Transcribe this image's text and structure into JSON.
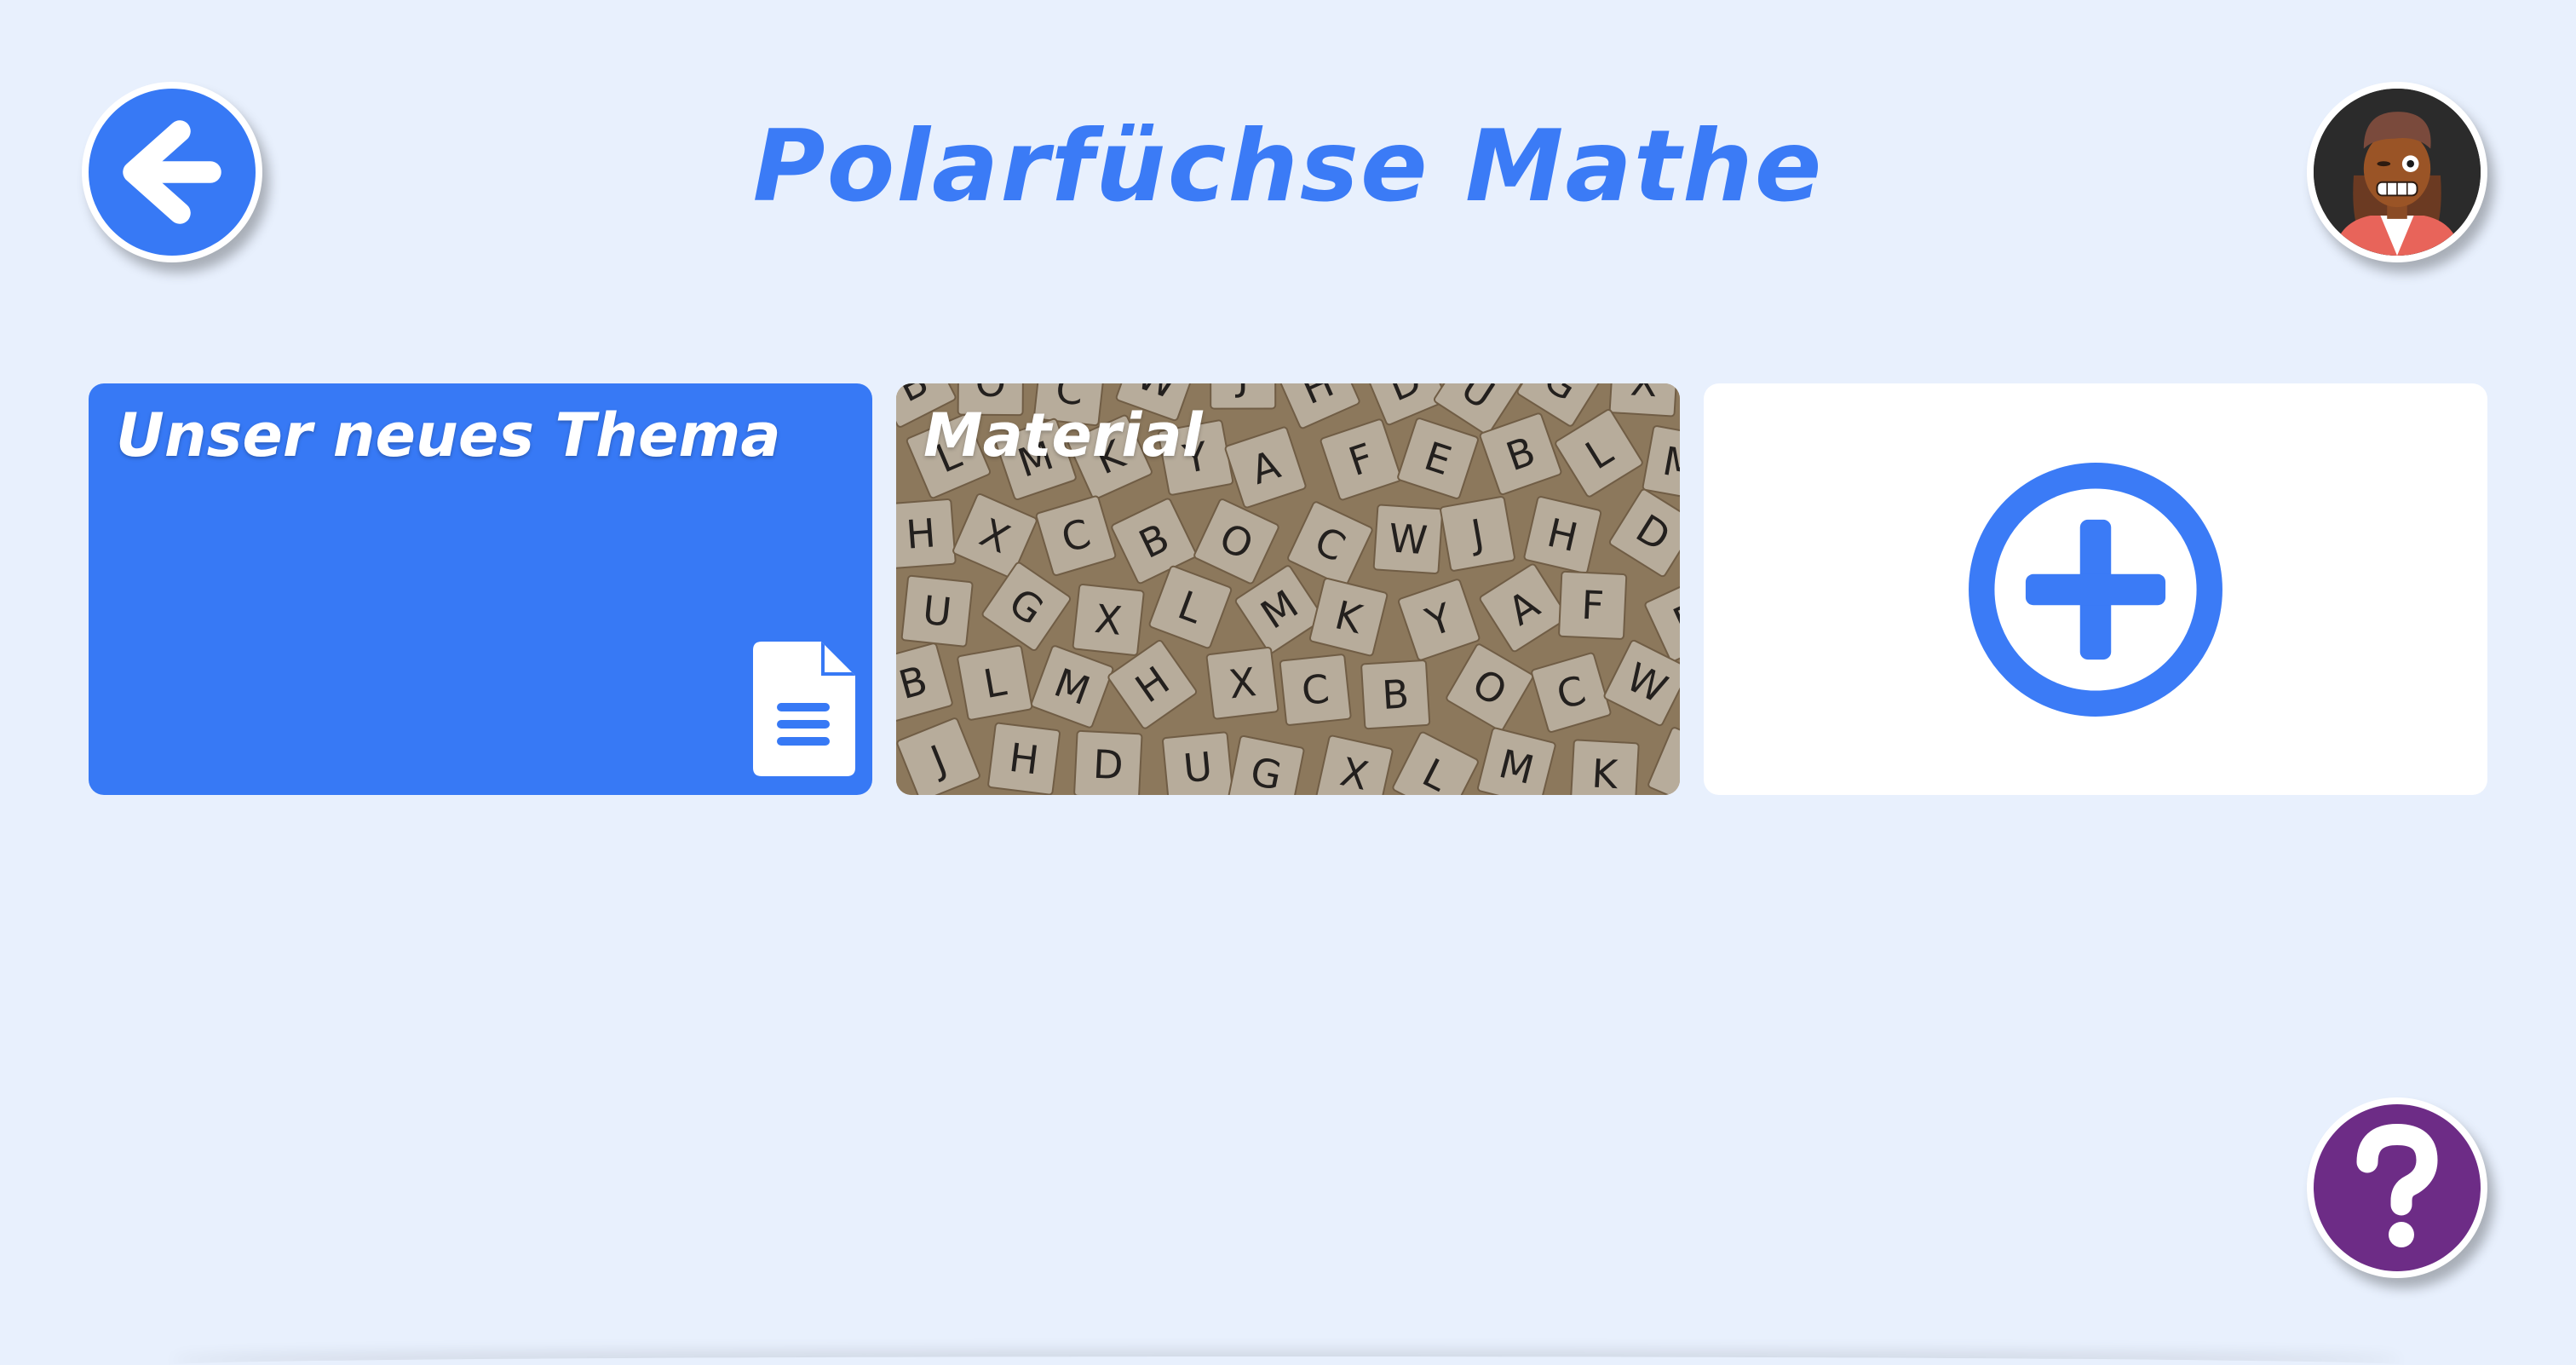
{
  "header": {
    "title": "Polarfüchse Mathe",
    "back_icon": "arrow-left-icon",
    "avatar_icon": "user-avatar"
  },
  "cards": [
    {
      "title": "Unser neues Thema",
      "icon": "document-icon",
      "color": "#3779f5"
    },
    {
      "title": "Material",
      "background": "letter-tiles-photo"
    },
    {
      "icon": "plus-circle-icon",
      "color": "#3b7bf6"
    }
  ],
  "help": {
    "icon": "question-mark-icon",
    "color": "#6d2c86"
  },
  "colors": {
    "background": "#e8f0fd",
    "accent": "#3779f5"
  }
}
